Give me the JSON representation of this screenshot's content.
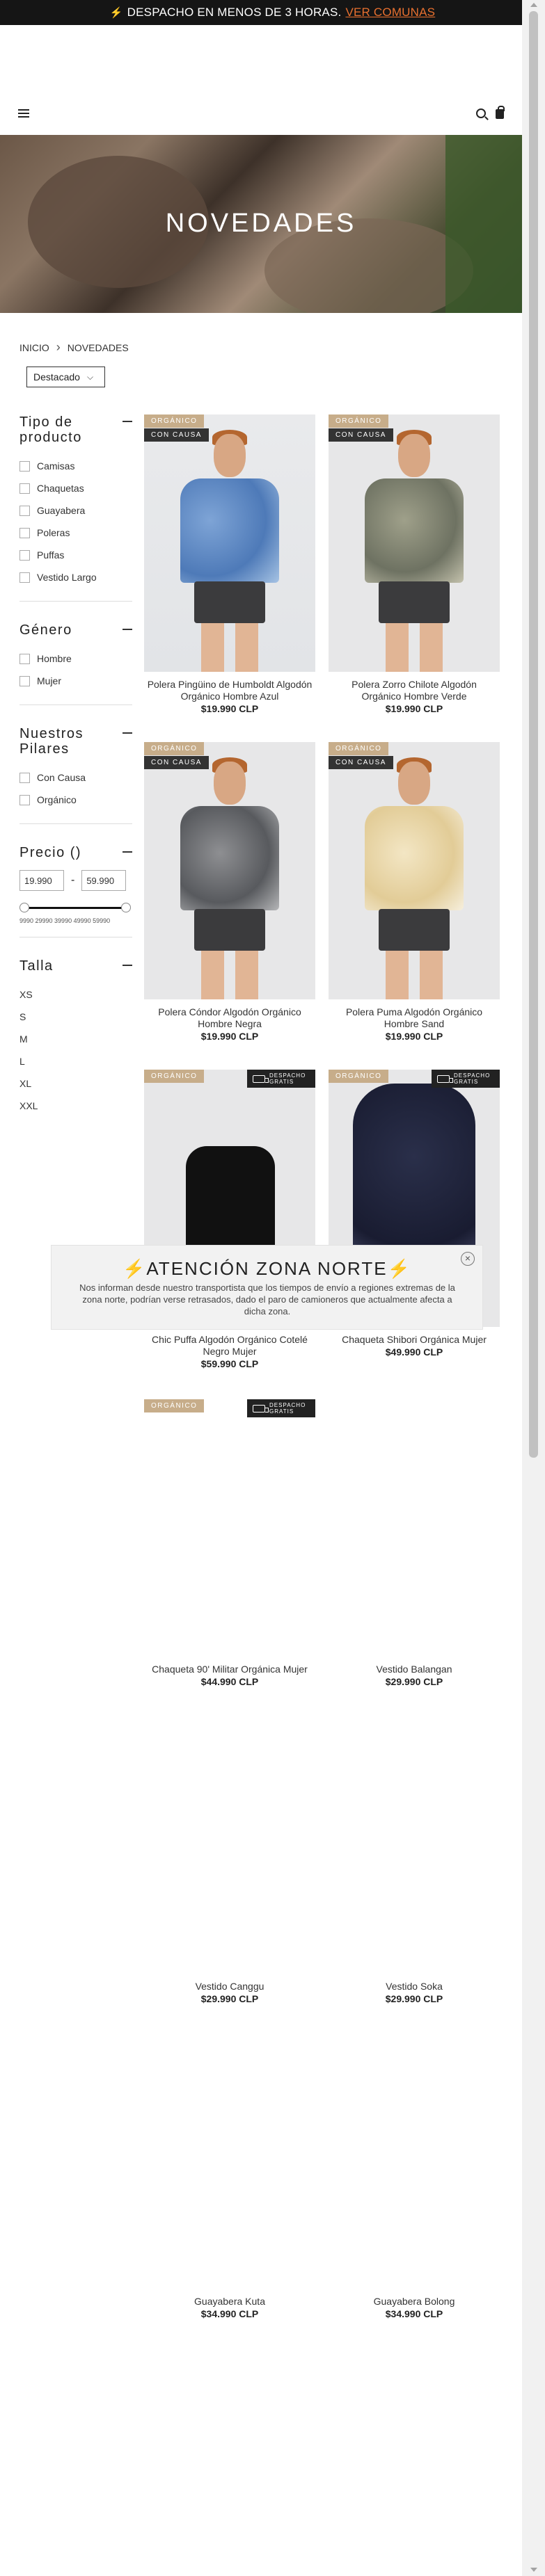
{
  "announcement": {
    "text": "DESPACHO EN MENOS DE 3 HORAS.",
    "link": "VER COMUNAS",
    "icon": "bolt-icon"
  },
  "header": {
    "menu_icon": "hamburger-icon",
    "search_icon": "search-icon",
    "cart_icon": "bag-icon"
  },
  "hero": {
    "title": "NOVEDADES"
  },
  "breadcrumb": {
    "home": "INICIO",
    "current": "NOVEDADES"
  },
  "sort": {
    "selected": "Destacado"
  },
  "filters": {
    "tipo": {
      "title": "Tipo de producto",
      "options": [
        "Camisas",
        "Chaquetas",
        "Guayabera",
        "Poleras",
        "Puffas",
        "Vestido Largo"
      ]
    },
    "genero": {
      "title": "Género",
      "options": [
        "Hombre",
        "Mujer"
      ]
    },
    "pilares": {
      "title": "Nuestros Pilares",
      "options": [
        "Con Causa",
        "Orgánico"
      ]
    },
    "precio": {
      "title": "Precio ()",
      "min": "19.990",
      "max": "59.990",
      "dash": "-",
      "ticks": "9990 29990 39990 49990 59990"
    },
    "talla": {
      "title": "Talla",
      "options": [
        "XS",
        "S",
        "M",
        "L",
        "XL",
        "XXL"
      ]
    }
  },
  "badges": {
    "organico": "ORGÁNICO",
    "causa": "CON CAUSA",
    "ship_line1": "DESPACHO",
    "ship_line2": "GRATIS"
  },
  "products": [
    {
      "name": "Polera Pingüino de Humboldt Algodón Orgánico Hombre Azul",
      "price": "$19.990 CLP"
    },
    {
      "name": "Polera Zorro Chilote Algodón Orgánico Hombre Verde",
      "price": "$19.990 CLP"
    },
    {
      "name": "Polera Cóndor Algodón Orgánico Hombre Negra",
      "price": "$19.990 CLP"
    },
    {
      "name": "Polera Puma Algodón Orgánico Hombre Sand",
      "price": "$19.990 CLP"
    },
    {
      "name": "Chic Puffa Algodón Orgánico Cotelé Negro Mujer",
      "price": "$59.990 CLP"
    },
    {
      "name": "Chaqueta Shibori Orgánica Mujer",
      "price": "$49.990 CLP"
    },
    {
      "name": "Chaqueta 90' Militar Orgánica Mujer",
      "price": "$44.990 CLP"
    },
    {
      "name": "Vestido Balangan",
      "price": "$29.990 CLP"
    },
    {
      "name": "Vestido Canggu",
      "price": "$29.990 CLP"
    },
    {
      "name": "Vestido Soka",
      "price": "$29.990 CLP"
    },
    {
      "name": "Guayabera Kuta",
      "price": "$34.990 CLP"
    },
    {
      "name": "Guayabera Bolong",
      "price": "$34.990 CLP"
    }
  ],
  "modal": {
    "title": "ATENCIÓN ZONA NORTE",
    "text": "Nos informan desde nuestro transportista que los tiempos de envío a regiones extremas de la zona norte, podrían verse retrasados, dado el paro de camioneros que actualmente afecta a dicha zona.",
    "close": "×"
  }
}
